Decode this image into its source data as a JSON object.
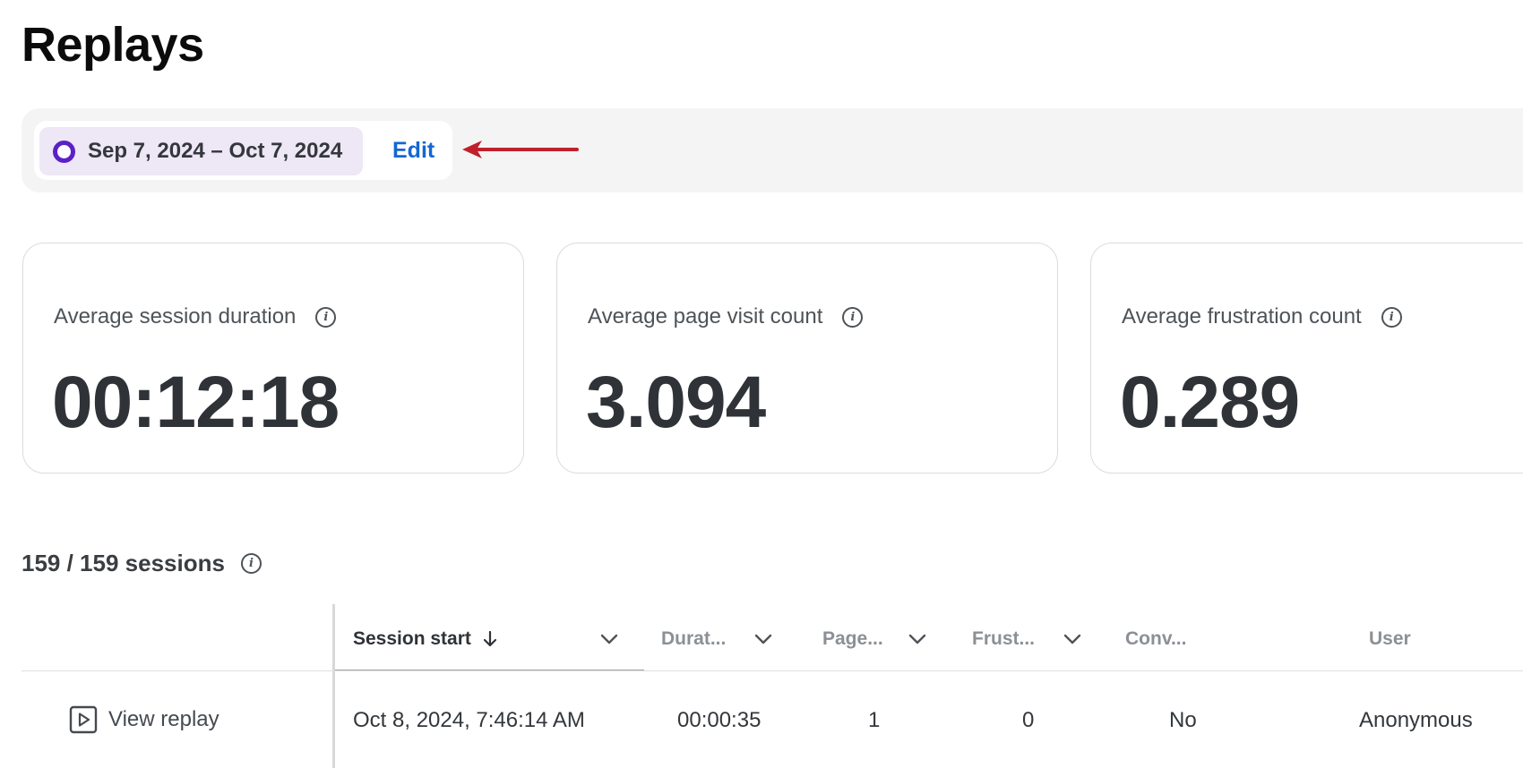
{
  "page": {
    "title": "Replays"
  },
  "filter": {
    "date_range": "Sep 7, 2024 – Oct 7, 2024",
    "edit_label": "Edit"
  },
  "metrics": [
    {
      "label": "Average session duration",
      "value": "00:12:18"
    },
    {
      "label": "Average page visit count",
      "value": "3.094"
    },
    {
      "label": "Average frustration count",
      "value": "0.289"
    }
  ],
  "sessions": {
    "count_label": "159 / 159 sessions"
  },
  "table": {
    "columns": [
      {
        "label": "Session start"
      },
      {
        "label": "Durat..."
      },
      {
        "label": "Page..."
      },
      {
        "label": "Frust..."
      },
      {
        "label": "Conv..."
      },
      {
        "label": "User"
      }
    ],
    "rows": [
      {
        "action": "View replay",
        "session_start": "Oct 8, 2024, 7:46:14 AM",
        "duration": "00:00:35",
        "pages": "1",
        "frustration": "0",
        "conversion": "No",
        "user": "Anonymous"
      }
    ]
  },
  "colors": {
    "accent_purple": "#5b21c6",
    "link_blue": "#1467d1",
    "arrow_red": "#c0202c",
    "chip_bg": "#ede7f6"
  }
}
